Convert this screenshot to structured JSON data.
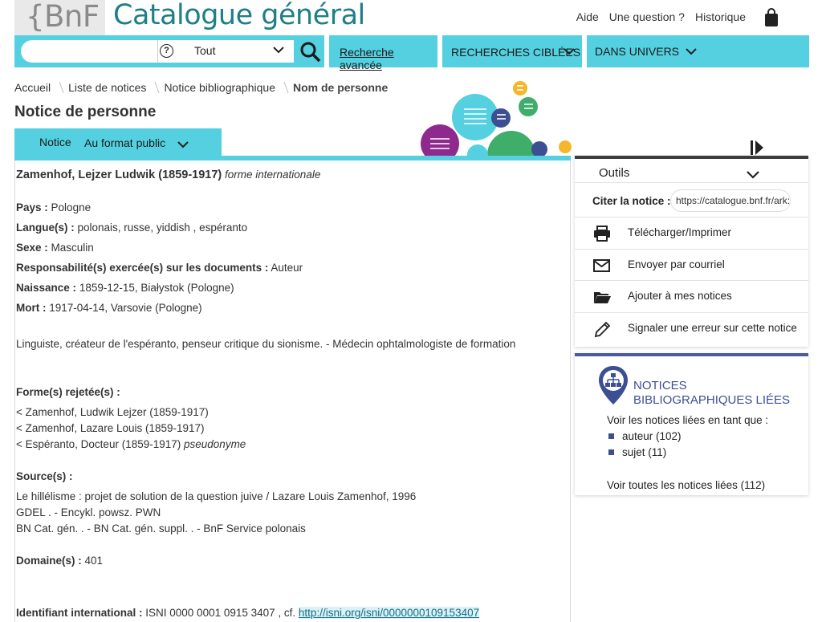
{
  "header": {
    "logo_text": "{BnF",
    "site_title": "Catalogue général",
    "links": [
      "Aide",
      "Une question ?",
      "Historique"
    ]
  },
  "search": {
    "placeholder": "",
    "scope": "Tout",
    "advanced_label": "Recherche avancée"
  },
  "nav": {
    "targeted": "RECHERCHES CIBLÉES",
    "universe": "DANS UNIVERS"
  },
  "breadcrumb": [
    "Accueil",
    "Liste de notices",
    "Notice bibliographique",
    "Nom de personne"
  ],
  "page_title": "Notice de personne",
  "notice_tab": {
    "label": "Notice",
    "format": "Au format public"
  },
  "record": {
    "name": "Zamenhof, Lejzer Ludwik (1859-1917)",
    "name_suffix": "forme internationale",
    "pays_label": "Pays :",
    "pays": "Pologne",
    "langues_label": "Langue(s) :",
    "langues": "polonais, russe, yiddish , espéranto",
    "sexe_label": "Sexe :",
    "sexe": "Masculin",
    "resp_label": "Responsabilité(s) exercée(s) sur les documents :",
    "resp": "Auteur",
    "naissance_label": "Naissance :",
    "naissance": "1859-12-15, Białystok (Pologne)",
    "mort_label": "Mort :",
    "mort": "1917-04-14, Varsovie (Pologne)",
    "description": "Linguiste, créateur de l'espéranto, penseur critique du sionisme. - Médecin ophtalmologiste de formation",
    "rejected_label": "Forme(s) rejetée(s) :",
    "rejected": [
      "< Zamenhof, Ludwik Lejzer (1859-1917)",
      "< Zamenhof, Lazare Louis (1859-1917)",
      "< Espéranto, Docteur (1859-1917)"
    ],
    "rejected_suffix": "pseudonyme",
    "sources_label": "Source(s) :",
    "sources": [
      "Le hillélisme : projet de solution de la question juive / Lazare Louis Zamenhof, 1996",
      "GDEL . - Encykl. powsz. PWN",
      "BN Cat. gén. . - BN Cat. gén. suppl. . - BnF Service polonais"
    ],
    "domaine_label": "Domaine(s) :",
    "domaine": "401",
    "id_label": "Identifiant international :",
    "id_value": "ISNI 0000 0001 0915 3407 , cf.",
    "id_link": "http://isni.org/isni/0000000109153407"
  },
  "tools": {
    "title": "Outils",
    "cite_label": "Citer la notice :",
    "cite_value": "https://catalogue.bnf.fr/ark:/",
    "items": [
      {
        "label": "Télécharger/Imprimer",
        "icon": "printer-icon"
      },
      {
        "label": "Envoyer par courriel",
        "icon": "envelope-icon"
      },
      {
        "label": "Ajouter à mes notices",
        "icon": "folder-icon"
      },
      {
        "label": "Signaler une erreur sur cette notice",
        "icon": "pencil-icon"
      }
    ]
  },
  "linked": {
    "title": "NOTICES BIBLIOGRAPHIQUES LIÉES",
    "intro": "Voir les notices liées en tant que :",
    "items": [
      "auteur (102)",
      "sujet (11)"
    ],
    "all": "Voir toutes les notices liées (112)"
  },
  "colors": {
    "accent": "#54d0e0",
    "title": "#1f7f86",
    "linked": "#3d4f93"
  }
}
